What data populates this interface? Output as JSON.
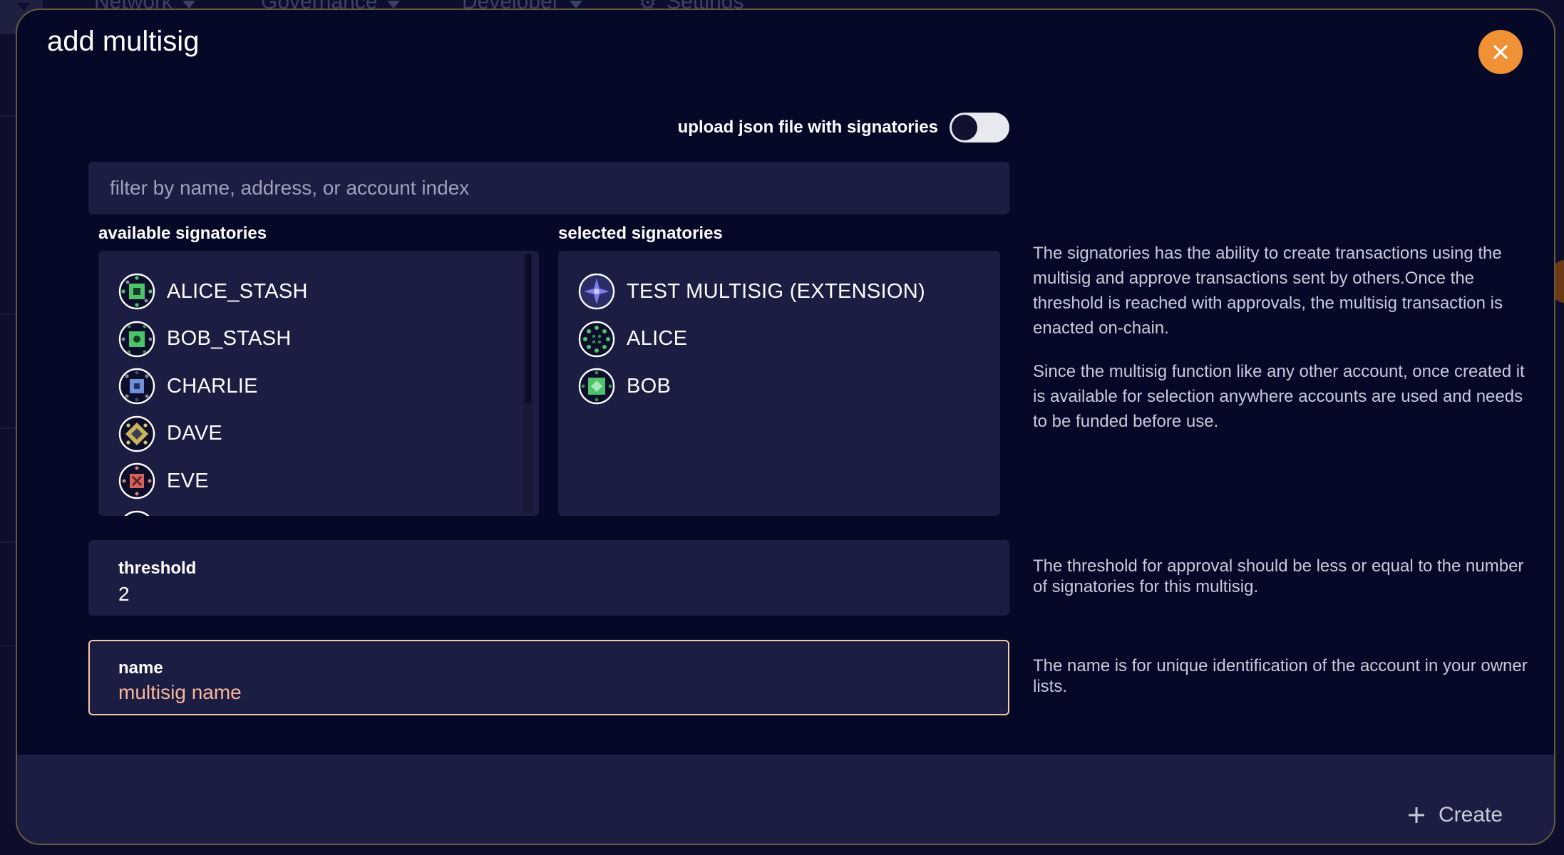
{
  "background": {
    "nav": [
      {
        "label": "Network"
      },
      {
        "label": "Governance"
      },
      {
        "label": "Developer"
      },
      {
        "label": "Settings"
      }
    ]
  },
  "modal": {
    "title": "add multisig",
    "close_icon": "close-icon",
    "upload_toggle": {
      "label": "upload json file with signatories",
      "enabled": false
    },
    "filter": {
      "placeholder": "filter by name, address, or account index",
      "value": ""
    },
    "available": {
      "label": "available signatories",
      "items": [
        {
          "name": "ALICE_STASH",
          "icon": "identicon"
        },
        {
          "name": "BOB_STASH",
          "icon": "identicon"
        },
        {
          "name": "CHARLIE",
          "icon": "identicon"
        },
        {
          "name": "DAVE",
          "icon": "identicon"
        },
        {
          "name": "EVE",
          "icon": "identicon"
        }
      ]
    },
    "selected": {
      "label": "selected signatories",
      "items": [
        {
          "name": "TEST MULTISIG (EXTENSION)",
          "icon": "identicon"
        },
        {
          "name": "ALICE",
          "icon": "identicon"
        },
        {
          "name": "BOB",
          "icon": "identicon"
        }
      ]
    },
    "signatories_help": [
      "The signatories has the ability to create transactions using the multisig and approve transactions sent by others.Once the threshold is reached with approvals, the multisig transaction is enacted on-chain.",
      "Since the multisig function like any other account, once created it is available for selection anywhere accounts are used and needs to be funded before use."
    ],
    "threshold": {
      "label": "threshold",
      "value": "2",
      "help": "The threshold for approval should be less or equal to the number of signatories for this multisig."
    },
    "name": {
      "label": "name",
      "placeholder": "multisig name",
      "value": "",
      "help": "The name is for unique identification of the account in your owner lists."
    },
    "create_button": {
      "label": "Create",
      "icon": "plus-icon"
    }
  },
  "colors": {
    "accent": "#f19135",
    "modal_bg": "#060827",
    "panel_bg": "#1b1d42",
    "focus_border": "#f7c8a6"
  }
}
